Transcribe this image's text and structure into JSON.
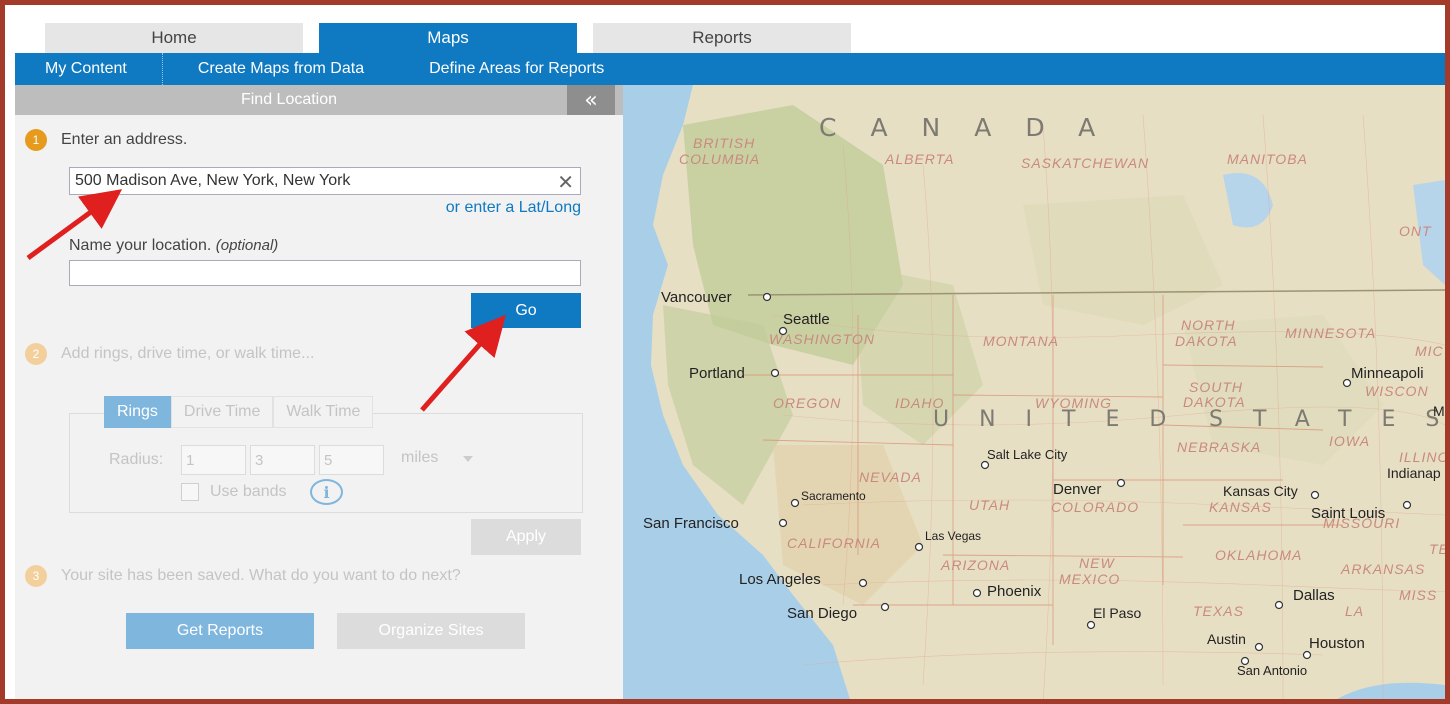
{
  "tabs": [
    {
      "label": "Home"
    },
    {
      "label": "Maps"
    },
    {
      "label": "Reports"
    }
  ],
  "subnav": {
    "my_content": "My Content",
    "create_maps": "Create Maps from Data",
    "define_areas": "Define Areas for Reports"
  },
  "panel": {
    "title": "Find Location",
    "collapse_glyph": "«",
    "step1": {
      "num": "1",
      "text": "Enter an address."
    },
    "address_value": "500 Madison Ave, New York, New York",
    "clear_glyph": "✕",
    "latlong_link": "or enter a Lat/Long",
    "name_label": "Name your location.",
    "name_optional": "(optional)",
    "name_value": "",
    "go_label": "Go",
    "step2": {
      "num": "2",
      "text": "Add rings, drive time, or walk time..."
    },
    "ring_tabs": [
      "Rings",
      "Drive Time",
      "Walk Time"
    ],
    "radius_label": "Radius:",
    "radius_values": [
      "1",
      "3",
      "5"
    ],
    "units": "miles",
    "use_bands": "Use bands",
    "info_glyph": "i",
    "apply_label": "Apply",
    "step3": {
      "num": "3",
      "text": "Your site has been saved. What do you want to do next?"
    },
    "get_reports": "Get Reports",
    "organize_sites": "Organize Sites"
  },
  "map": {
    "country_canada": "CANADA",
    "country_us_1": "UNITED",
    "country_us_2": "STATES",
    "regions": {
      "british_columbia_1": "BRITISH",
      "british_columbia_2": "COLUMBIA",
      "alberta": "ALBERTA",
      "saskatchewan": "SASKATCHEWAN",
      "manitoba": "MANITOBA",
      "ontario": "ONT",
      "washington": "WASHINGTON",
      "montana": "MONTANA",
      "north_dakota_1": "NORTH",
      "north_dakota_2": "DAKOTA",
      "minnesota": "MINNESOTA",
      "mic": "MIC",
      "oregon": "OREGON",
      "idaho": "IDAHO",
      "wyoming": "WYOMING",
      "south_dakota_1": "SOUTH",
      "south_dakota_2": "DAKOTA",
      "wiscon": "WISCON",
      "nebraska": "NEBRASKA",
      "iowa": "IOWA",
      "illino": "ILLINO",
      "nevada": "NEVADA",
      "utah": "UTAH",
      "colorado": "COLORADO",
      "kansas": "KANSAS",
      "missouri": "MISSOURI",
      "california": "CALIFORNIA",
      "arizona": "ARIZONA",
      "new_mexico_1": "NEW",
      "new_mexico_2": "MEXICO",
      "oklahoma": "OKLAHOMA",
      "arkansas": "ARKANSAS",
      "te": "TE",
      "texas": "TEXAS",
      "la": "LA",
      "miss": "MISS"
    },
    "cities": {
      "vancouver": "Vancouver",
      "seattle": "Seattle",
      "portland": "Portland",
      "minneapolis": "Minneapoli",
      "salt_lake_city": "Salt Lake City",
      "denver": "Denver",
      "kansas_city": "Kansas City",
      "indianapolis": "Indianap",
      "sacramento": "Sacramento",
      "saint_louis": "Saint Louis",
      "san_francisco": "San Francisco",
      "las_vegas": "Las Vegas",
      "los_angeles": "Los Angeles",
      "phoenix": "Phoenix",
      "dallas": "Dallas",
      "san_diego": "San Diego",
      "el_paso": "El Paso",
      "austin": "Austin",
      "houston": "Houston",
      "san_antonio": "San Antonio",
      "m": "M"
    }
  },
  "colors": {
    "accent": "#0f79c1",
    "accent_light": "#7fb6de",
    "frame": "#a33a2a",
    "step_orange": "#e69a1e",
    "annotation_arrow": "#e01f1f",
    "water": "#a9cfe8",
    "land": "#e7dfc4"
  }
}
